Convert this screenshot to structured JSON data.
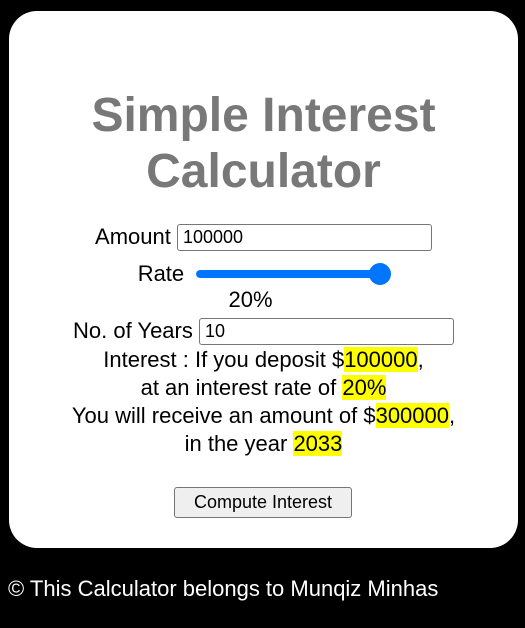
{
  "title_line1": "Simple Interest",
  "title_line2": "Calculator",
  "form": {
    "amount_label": "Amount",
    "amount_value": "100000",
    "rate_label": "Rate",
    "rate_value_text": "20%",
    "rate_fraction": 0.95,
    "years_label": "No. of Years",
    "years_value": "10"
  },
  "result": {
    "line1_prefix": "Interest : If you deposit $",
    "line1_amount": "100000",
    "line1_suffix": ",",
    "line2_prefix": "at an interest rate of ",
    "line2_rate": "20%",
    "line3_prefix": "You will receive an amount of $",
    "line3_total": "300000",
    "line3_suffix": ",",
    "line4_prefix": "in the year ",
    "line4_year": "2033"
  },
  "button_label": "Compute Interest",
  "footer_text": "© This Calculator belongs to Munqiz Minhas",
  "colors": {
    "page_background": "#000000",
    "card_background": "#ffffff",
    "title_color": "#787878",
    "slider_accent": "#0075ff",
    "highlight": "#ffff00"
  }
}
